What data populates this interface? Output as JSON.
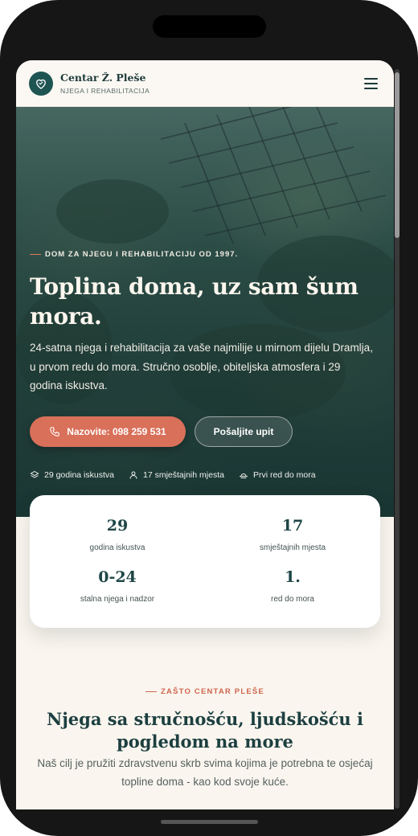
{
  "header": {
    "brand_name": "Centar Ž. Pleše",
    "brand_sub": "NJEGA I REHABILITACIJA",
    "logo_icon": "heart-icon",
    "menu_icon": "hamburger-menu-icon"
  },
  "hero": {
    "eyebrow": "DOM ZA NJEGU I REHABILITACIJU OD 1997.",
    "title": "Toplina doma, uz sam šum mora.",
    "text": "24-satna njega i rehabilitacija za vaše najmilije u mirnom dijelu Dramlja, u prvom redu do mora. Stručno osoblje, obiteljska atmosfera i 29 godina iskustva.",
    "call_button": "Nazovite: 098 259 531",
    "inquiry_button": "Pošaljite upit",
    "features": [
      {
        "icon": "layers-icon",
        "label": "29 godina iskustva"
      },
      {
        "icon": "user-icon",
        "label": "17 smještajnih mjesta"
      },
      {
        "icon": "sunset-icon",
        "label": "Prvi red do mora"
      }
    ]
  },
  "stats": [
    {
      "value": "29",
      "label": "godina iskustva"
    },
    {
      "value": "17",
      "label": "smještajnih mjesta"
    },
    {
      "value": "0-24",
      "label": "stalna njega i nadzor"
    },
    {
      "value": "1.",
      "label": "red do mora"
    }
  ],
  "why": {
    "eyebrow": "ZAŠTO CENTAR PLEŠE",
    "title": "Njega sa stručnošću, ljudskošću i pogledom na more",
    "text": "Naš cilj je pružiti zdravstvenu skrb svima kojima je potrebna te osjećaj topline doma - kao kod svoje kuće."
  },
  "colors": {
    "accent": "#d9705a",
    "brand": "#1e5553",
    "background": "#faf6ef"
  }
}
